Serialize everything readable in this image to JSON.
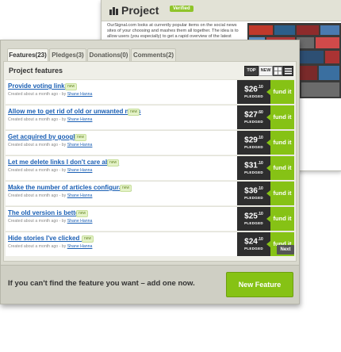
{
  "background_window": {
    "title": "Project",
    "verified_label": "Verified",
    "description": "OurSignal.com looks at currently popular items on the social news sites of your choosing and mashes them all together. The idea is to allow users (you especially) to get a rapid overview of the latest"
  },
  "tabs": [
    {
      "label": "Features(23)"
    },
    {
      "label": "Pledges(3)"
    },
    {
      "label": "Donations(0)"
    },
    {
      "label": "Comments(2)"
    }
  ],
  "section_title": "Project features",
  "view_buttons": {
    "top": "TOP",
    "new": "NEW"
  },
  "features": [
    {
      "title": "Provide voting links.",
      "badge": "new",
      "meta_prefix": "Created about a month ago - by",
      "author": "Shane Hanna",
      "amount": "$26",
      "amount_sup": ".10",
      "pledged_label": "PLEDGED",
      "fund_label": "fund it"
    },
    {
      "title": "Allow me to get rid of old or unwanted news",
      "badge": "new",
      "meta_prefix": "Created about a month ago - by",
      "author": "Shane Hanna",
      "amount": "$27",
      "amount_sup": ".60",
      "pledged_label": "PLEDGED",
      "fund_label": "fund it"
    },
    {
      "title": "Get acquired by google.",
      "badge": "new",
      "meta_prefix": "Created about a month ago - by",
      "author": "Shane Hanna",
      "amount": "$29",
      "amount_sup": ".10",
      "pledged_label": "PLEDGED",
      "fund_label": "fund it"
    },
    {
      "title": "Let me delete links I don't care about",
      "badge": "new",
      "meta_prefix": "Created about a month ago - by",
      "author": "Shane Hanna",
      "amount": "$31",
      "amount_sup": ".10",
      "pledged_label": "PLEDGED",
      "fund_label": "fund it"
    },
    {
      "title": "Make the number of articles configurable",
      "badge": "new",
      "meta_prefix": "Created about a month ago - by",
      "author": "Shane Hanna",
      "amount": "$36",
      "amount_sup": ".10",
      "pledged_label": "PLEDGED",
      "fund_label": "fund it"
    },
    {
      "title": "The old version is better",
      "badge": "new",
      "meta_prefix": "Created about a month ago - by",
      "author": "Shane Hanna",
      "amount": "$25",
      "amount_sup": ".10",
      "pledged_label": "PLEDGED",
      "fund_label": "fund it"
    },
    {
      "title": "Hide stories I've clicked on",
      "badge": "new",
      "meta_prefix": "Created about a month ago - by",
      "author": "Shane Hanna",
      "amount": "$24",
      "amount_sup": ".10",
      "pledged_label": "PLEDGED",
      "fund_label": "fund it"
    }
  ],
  "pagination": {
    "next_label": "Next"
  },
  "footer": {
    "cta_text": "If you can't find the feature you want – add one now.",
    "new_feature_label": "New Feature"
  },
  "colors": {
    "accent_green": "#86c215",
    "link_blue": "#1a5fb4",
    "dark": "#2e2e2e"
  },
  "icons": [
    "project-icon",
    "grid-view-icon",
    "list-view-icon"
  ]
}
